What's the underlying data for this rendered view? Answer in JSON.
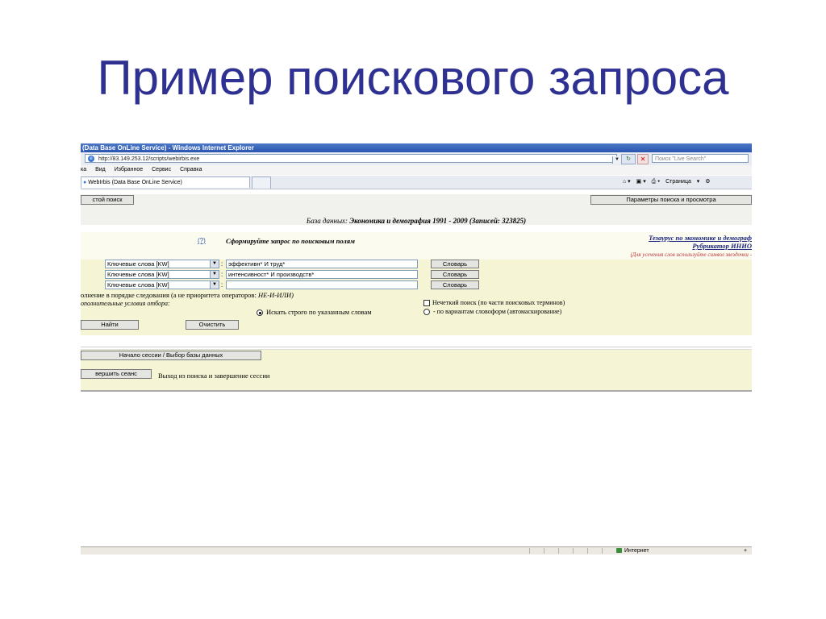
{
  "slide": {
    "title": "Пример поискового запроса"
  },
  "browser": {
    "window_title": "(Data Base OnLine Service) - Windows Internet Explorer",
    "address": "http://83.149.253.12/scripts/webirbis.exe",
    "live_search_placeholder": "Поиск \"Live Search\"",
    "menu": [
      "ка",
      "Вид",
      "Избранное",
      "Сервис",
      "Справка"
    ],
    "tab_label": "WebIrbis (Data Base OnLine Service)",
    "tools": [
      "Страница"
    ],
    "status_zone": "Интернет",
    "zoom_icon": "+"
  },
  "page": {
    "simple_search_btn": "стой поиск",
    "params_btn": "Параметры поиска и просмотра",
    "db_label": "База данных:",
    "db_name": "Экономика и демография 1991 - 2009",
    "db_records": "(Записей: 323825)",
    "help_link": "(?)",
    "query_title": "Сформируйте запрос по поисковым полям",
    "thesaurus_link": "Тезаурус по экономике и демограф",
    "rubricator_link": "Рубрикатор ИНИО",
    "truncation_hint": "(Для усечения слов используйте символ звездочки -",
    "rows": [
      {
        "field": "Ключевые слова [KW]",
        "value": "эффективн* И труд*",
        "vocab": "Словарь"
      },
      {
        "field": "Ключевые слова [KW]",
        "value": "интенсивност* И производств*",
        "vocab": "Словарь"
      },
      {
        "field": "Ключевые слова [KW]",
        "value": "",
        "vocab": "Словарь"
      }
    ],
    "order_text": "олнение в порядке следования (а не приоритета операторов:",
    "order_ops": "НЕ-И-ИЛИ)",
    "extra_conditions": "ополнительные условия отбора:",
    "fuzzy_label": "Нечеткий поиск (по части поисковых терминов)",
    "strict_label": "Искать строго по указанным словам",
    "wordforms_label": "- по вариантам словоформ (автомаскирование)",
    "find_btn": "Найти",
    "clear_btn": "Очистить",
    "session_btn": "Начало сессии / Выбор базы данных",
    "end_session_btn": "вершить сеанс",
    "exit_text": "Выход из поиска и завершение сессии"
  },
  "colors": {
    "title": "#2e3192",
    "panel": "#f5f5d6",
    "link": "#1a237e"
  }
}
